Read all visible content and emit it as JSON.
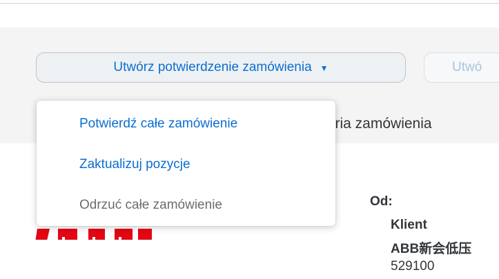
{
  "toolbar": {
    "create_confirmation_label": "Utwórz potwierdzenie zamówienia",
    "secondary_button_label": "Utwó"
  },
  "tabs": {
    "order_history_label": "toria zamówienia"
  },
  "confirmation_menu": {
    "items": [
      {
        "label": "Potwierdź całe zamówienie",
        "enabled": true
      },
      {
        "label": "Zaktualizuj pozycje",
        "enabled": true
      },
      {
        "label": "Odrzuć całe zamówienie",
        "enabled": false
      }
    ]
  },
  "from_section": {
    "label": "Od:",
    "lines": [
      "Klient",
      "ABB新会低压",
      "529100"
    ]
  },
  "colors": {
    "accent": "#0a6ed1",
    "logo_red": "#e30613"
  },
  "icons": {
    "dropdown": "caret-down-icon"
  }
}
